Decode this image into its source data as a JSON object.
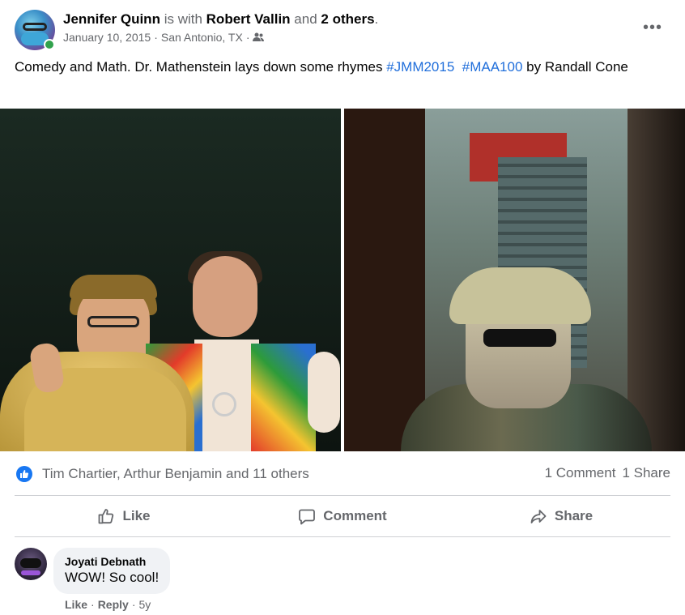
{
  "post": {
    "author": "Jennifer Quinn",
    "with_text": " is with ",
    "tagged_person": "Robert Vallin",
    "and_text": " and ",
    "others": "2 others",
    "period": ".",
    "date": "January 10, 2015",
    "separator": " · ",
    "location": "San Antonio, TX",
    "separator2": " ·",
    "audience_icon": "friends-icon",
    "more_icon": "more-options-icon",
    "more_label": "•••",
    "caption_text": "Comedy and Math.  Dr.  Mathenstein lays down some rhymes ",
    "hashtag1": "#JMM2015",
    "hashtag2": "#MAA100",
    "caption_tail": "  by Randall Cone"
  },
  "stats": {
    "reactors": "Tim Chartier, Arthur Benjamin and 11 others",
    "comments": "1 Comment",
    "shares": "1 Share"
  },
  "actions": {
    "like": "Like",
    "comment": "Comment",
    "share": "Share"
  },
  "comment": {
    "author": "Joyati Debnath",
    "text": "WOW! So cool!",
    "like": "Like",
    "dot": "·",
    "reply": "Reply",
    "dot2": "·",
    "time": "5y"
  },
  "colors": {
    "accent": "#1877f2",
    "hashtag": "#216fdb",
    "muted": "#65676b",
    "online": "#31a24c"
  }
}
